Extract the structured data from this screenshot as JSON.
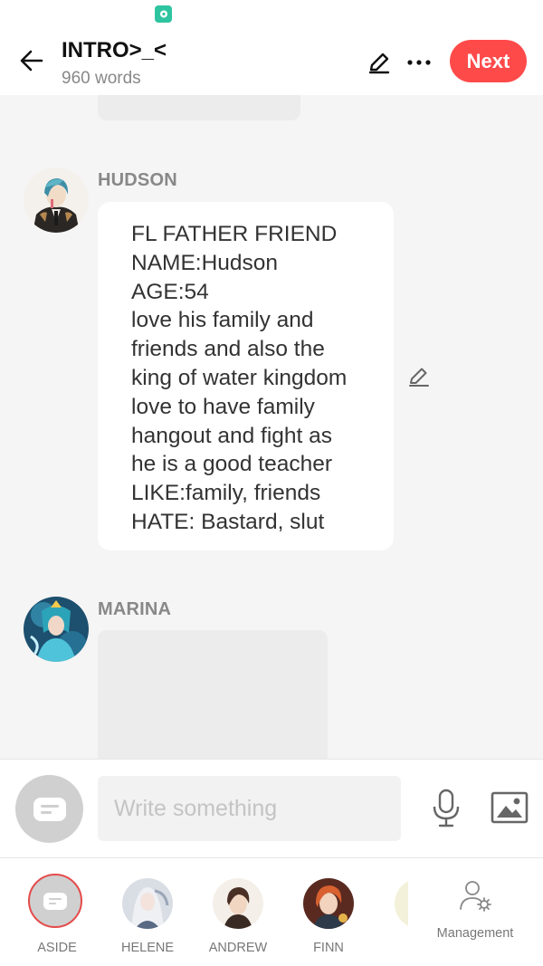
{
  "header": {
    "title": "INTRO>_<",
    "word_count": "960 words",
    "next_label": "Next"
  },
  "messages": [
    {
      "character": "HUDSON",
      "lines": [
        "FL FATHER FRIEND",
        "NAME:Hudson",
        "AGE:54",
        "love his family and",
        "friends and also the",
        "king of water kingdom",
        "love to have family",
        "hangout and fight as",
        "he is a good teacher",
        "LIKE:family, friends",
        "HATE: Bastard, slut"
      ]
    },
    {
      "character": "MARINA"
    }
  ],
  "composer": {
    "placeholder": "Write something"
  },
  "character_bar": {
    "items": [
      {
        "label": "ASIDE"
      },
      {
        "label": "HELENE"
      },
      {
        "label": "ANDREW"
      },
      {
        "label": "FINN"
      }
    ],
    "management_label": "Management"
  },
  "colors": {
    "accent": "#ff4a4a",
    "background": "#f5f5f5",
    "bubble": "#ffffff",
    "status_app_icon": "#2ec4a0"
  },
  "icons": {
    "back": "arrow-left-icon",
    "edit": "pencil-icon",
    "more": "ellipsis-icon",
    "mic": "microphone-icon",
    "image": "image-icon",
    "management": "user-gear-icon"
  }
}
